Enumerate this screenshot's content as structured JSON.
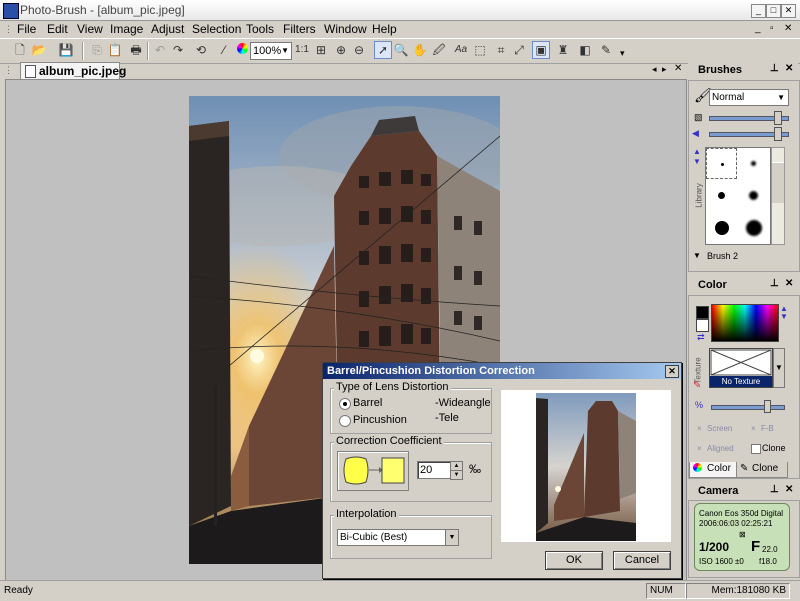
{
  "window": {
    "title": "Photo-Brush - [album_pic.jpeg]"
  },
  "menu": [
    "File",
    "Edit",
    "View",
    "Image",
    "Adjust",
    "Selection",
    "Tools",
    "Filters",
    "Window",
    "Help"
  ],
  "toolbar": {
    "zoom": "100%",
    "one_to_one": "1:1"
  },
  "document": {
    "tab_label": "album_pic.jpeg"
  },
  "brushes": {
    "title": "Brushes",
    "mode": "Normal",
    "library_label": "Library",
    "brush_name": "Brush 2"
  },
  "color": {
    "title": "Color",
    "texture_label": "Texture",
    "no_texture": "No Texture",
    "screen_label": "Screen",
    "fb_label": "F-B",
    "aligned_label": "Aligned",
    "clone_label": "Clone",
    "tab_color": "Color",
    "tab_clone": "Clone"
  },
  "camera": {
    "title": "Camera",
    "model": "Canon Eos 350d Digital",
    "datetime": "2006:06:03 02:25:21",
    "shutter": "1/200",
    "f_label": "F",
    "f_value": "22.0",
    "iso": "ISO 1600 ±0",
    "focal": "f18.0"
  },
  "dialog": {
    "title": "Barrel/Pincushion Distortion Correction",
    "lens_group": "Type of Lens Distortion",
    "barrel": "Barrel",
    "barrel_hint": "-Wideangle",
    "pincushion": "Pincushion",
    "pincushion_hint": "-Tele",
    "coef_group": "Correction Coefficient",
    "coef_value": "20",
    "coef_unit": "‰",
    "interp_group": "Interpolation",
    "interp_value": "Bi-Cubic (Best)",
    "ok": "OK",
    "cancel": "Cancel"
  },
  "status": {
    "left": "Ready",
    "num": "NUM",
    "mem": "Mem:181080 KB"
  },
  "colors": {
    "accent": "#0a246a",
    "chrome": "#d4d0c8",
    "workspace": "#c0c0c0"
  }
}
